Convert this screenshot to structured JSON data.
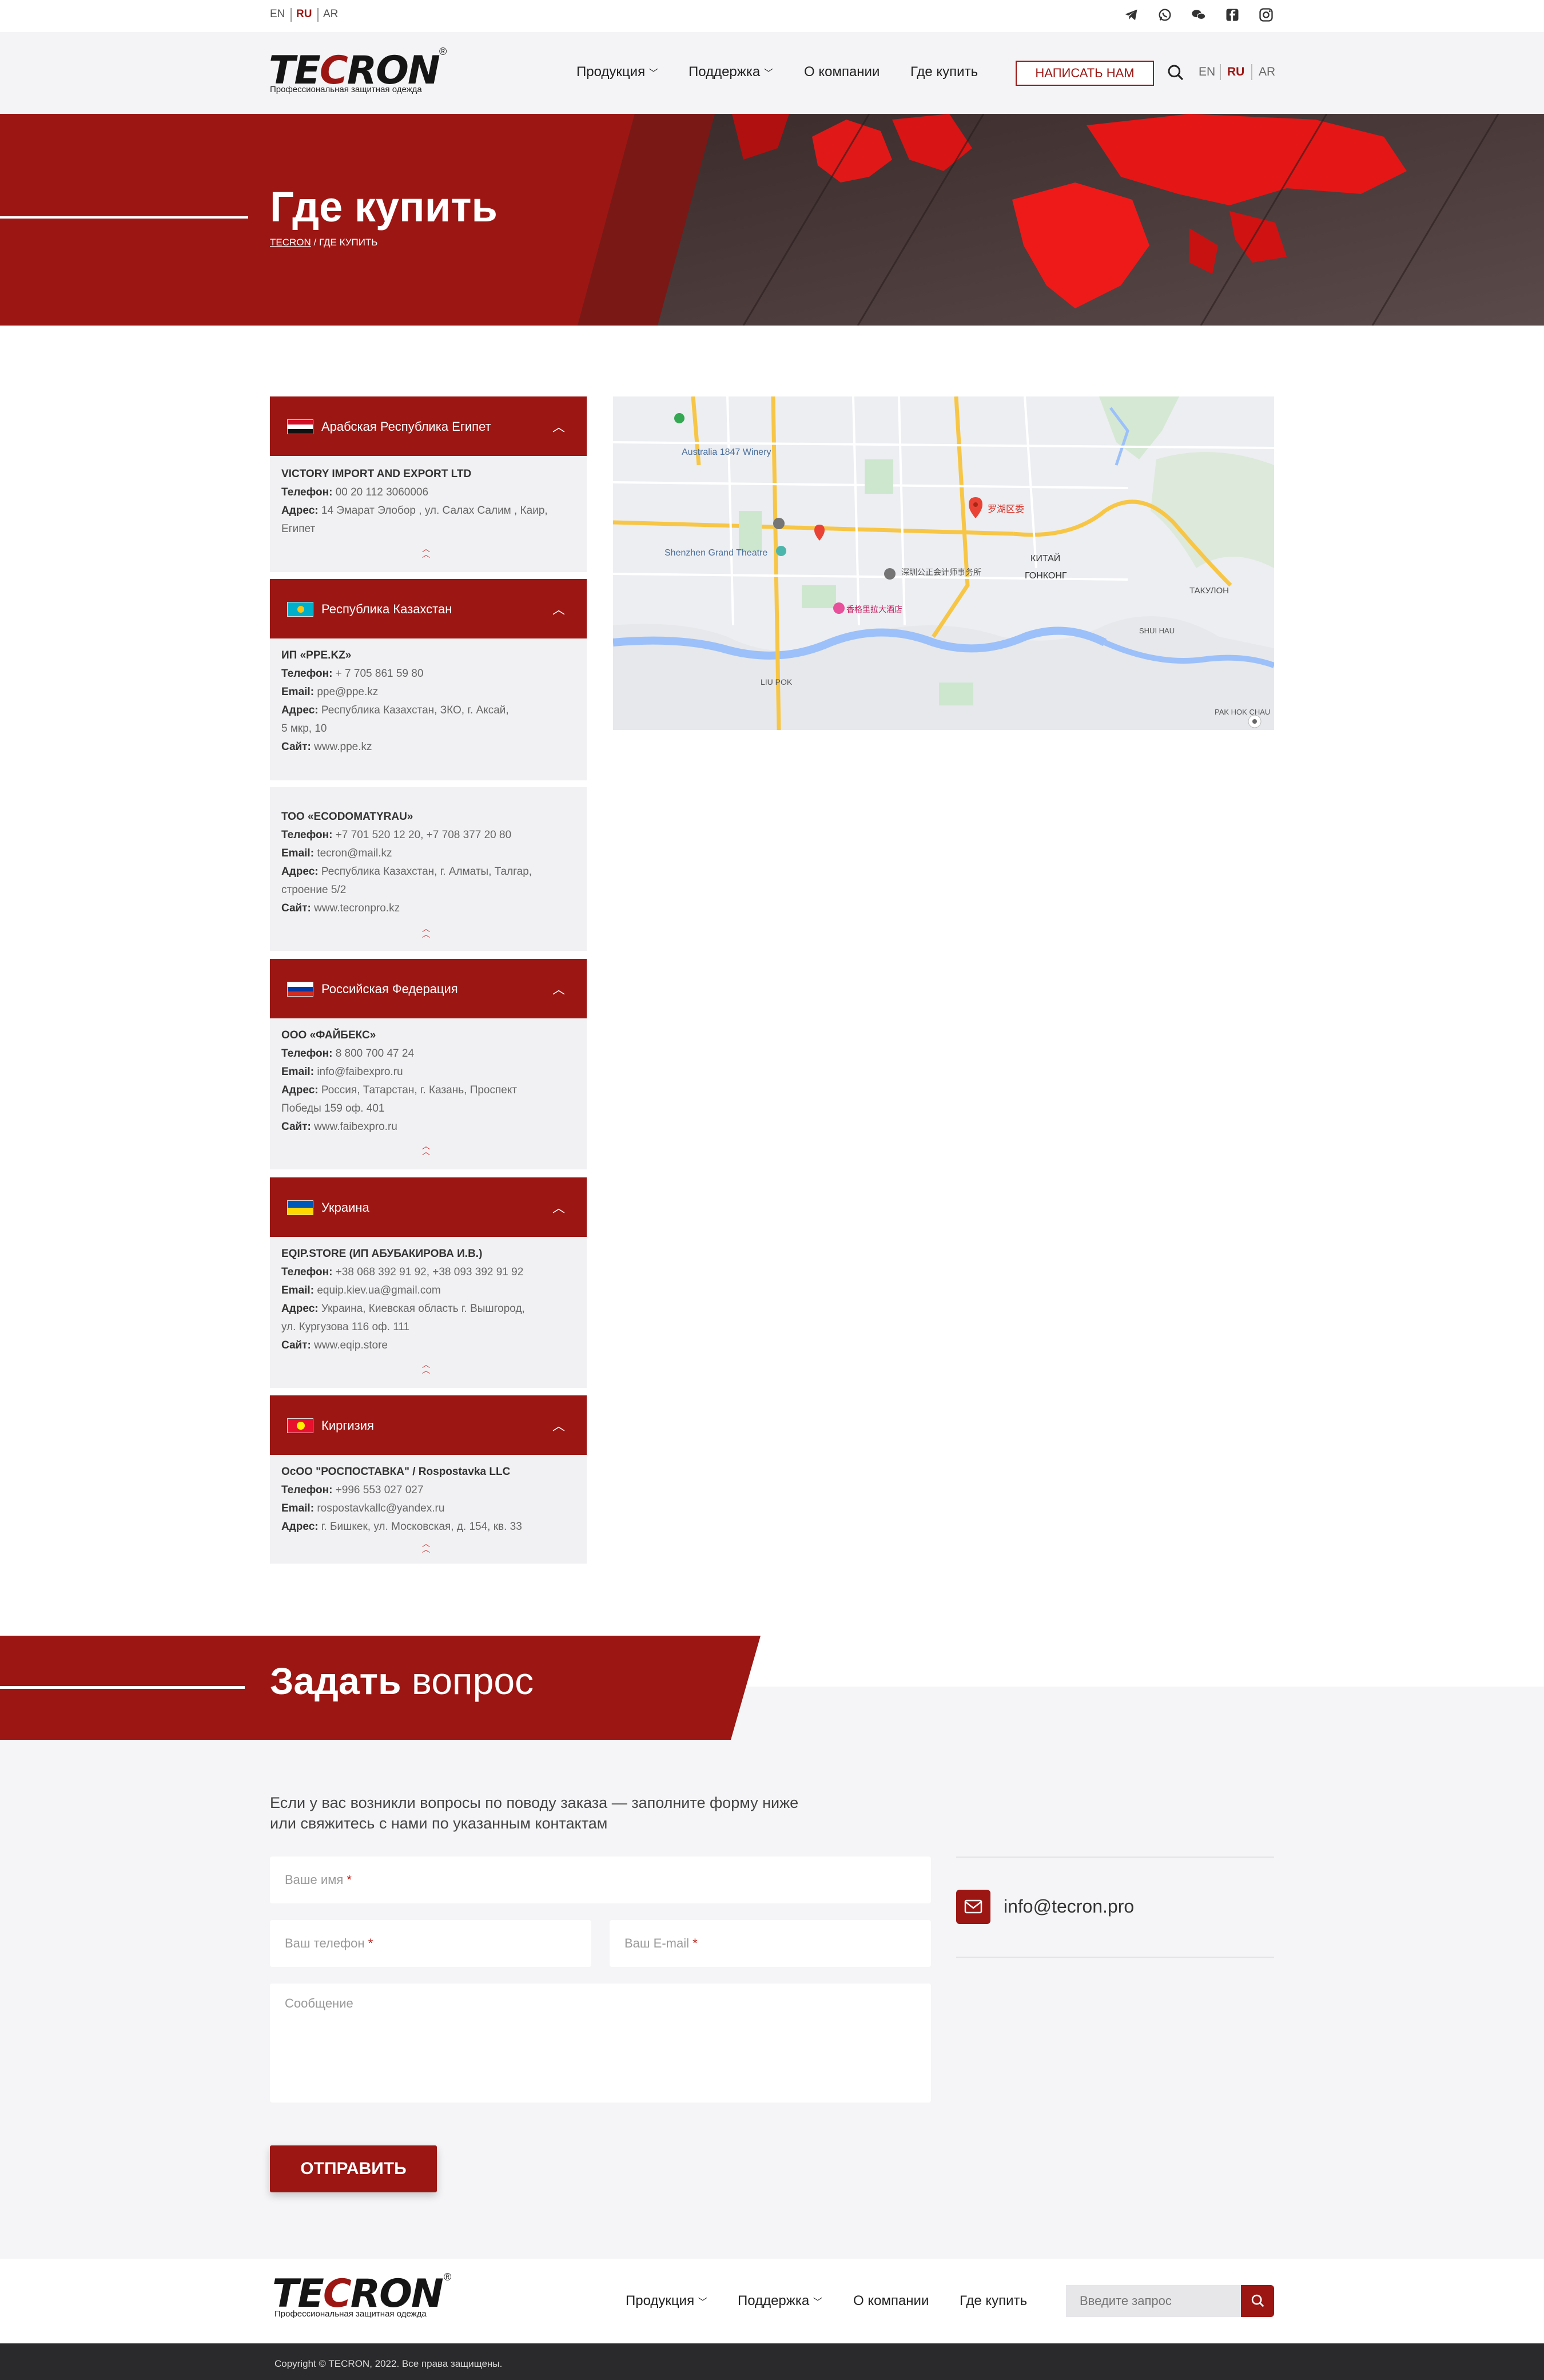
{
  "top_langs": [
    "EN",
    "RU",
    "AR"
  ],
  "social": [
    "telegram-icon",
    "whatsapp-icon",
    "wechat-icon",
    "facebook-icon",
    "instagram-icon"
  ],
  "header": {
    "logo": "TECRON",
    "logo_mark": "®",
    "logo_sub": "Профессиональная защитная одежда",
    "nav": [
      "Продукция",
      "Поддержка",
      "О компании",
      "Где купить"
    ],
    "write_btn": "НАПИСАТЬ НАМ",
    "langs": [
      "EN",
      "RU",
      "AR"
    ]
  },
  "hero": {
    "title": "Где купить",
    "crumb_home": "TECRON",
    "crumb_current": " / ГДЕ КУПИТЬ"
  },
  "countries": [
    {
      "name": "Арабская Республика Египет",
      "dealers": [
        {
          "company": "VICTORY IMPORT AND EXPORT LTD",
          "phone": "00 20 112 3060006",
          "address_l1": "14 Эмарат Элобор , ул. Салах Салим , Каир,",
          "address_l2": "Египет"
        }
      ]
    },
    {
      "name": "Республика Казахстан",
      "dealers": [
        {
          "company": "ИП «PPE.KZ»",
          "phone": "+ 7 705 861 59 80",
          "email": "ppe@ppe.kz",
          "address_l1": "Республика Казахстан, ЗКО, г. Аксай,",
          "address_l2": "5 мкр, 10",
          "site": "www.ppe.kz"
        },
        {
          "company": "ТОО «ECODOMATYRAU»",
          "phone": "+7 701 520 12 20, +7  708  377 20 80",
          "email": "tecron@mail.kz",
          "address_l1": "Республика Казахстан, г. Алматы, Талгар,",
          "address_l2": "строение 5/2",
          "site": "www.tecronpro.kz"
        }
      ]
    },
    {
      "name": "Российская Федерация",
      "dealers": [
        {
          "company": "ООО «ФАЙБЕКС»",
          "phone": "8  800  700 47 24",
          "email": "info@faibexpro.ru",
          "address_l1": "Россия, Татарстан, г. Казань, Проспект",
          "address_l2": "Победы 159 оф. 401",
          "site": "www.faibexpro.ru"
        }
      ]
    },
    {
      "name": "Украина",
      "dealers": [
        {
          "company": "EQIP.STORE (ИП АБУБАКИРОВА И.В.)",
          "phone": "+38 068 392 91 92, +38 093 392 91 92",
          "email": "equip.kiev.ua@gmail.com",
          "address_l1": "Украина, Киевская область г. Вышгород,",
          "address_l2": "ул. Кургузова 116 оф. 111",
          "site": "www.eqip.store"
        }
      ]
    },
    {
      "name": "Киргизия",
      "dealers": [
        {
          "company": "ОсОО \"РОСПОСТАВКА\" / Rospostavka LLC",
          "phone": "+996 553 027 027",
          "email": "rospostavkallc@yandex.ru",
          "address_l1": "г. Бишкек, ул. Московская, д. 154, кв. 33"
        }
      ]
    }
  ],
  "labels": {
    "phone": "Телефон:",
    "email": "Email:",
    "address": "Адрес:",
    "site": "Сайт:"
  },
  "map": {
    "labels": [
      "Australia 1847 Winery",
      "Shenzhen Grand Theatre",
      "罗湖区委",
      "КИТАЙ",
      "ГОНКОНГ",
      "ТАКУЛОН",
      "LIU POK",
      "SHUI HAU",
      "PAK HOK CHAU",
      "香格里拉大酒店",
      "深圳公正会计师事务所"
    ]
  },
  "ask": {
    "title_bold": "Задать",
    "title_rest": " вопрос",
    "desc_l1": "Если у вас возникли вопросы по поводу заказа — заполните форму ниже",
    "desc_l2": "или свяжитесь с нами по указанным контактам",
    "name_ph": "Ваше имя",
    "phone_ph": "Ваш телефон",
    "email_ph": "Ваш E-mail",
    "message_ph": "Сообщение",
    "required_mark": "*",
    "send": "ОТПРАВИТЬ",
    "contact_email": "info@tecron.pro"
  },
  "footer": {
    "nav": [
      "Продукция",
      "Поддержка",
      "О компании",
      "Где купить"
    ],
    "search_ph": "Введите запрос",
    "copyright": "Copyright © TECRON, 2022. Все права защищены."
  },
  "colors": {
    "brand": "#9c1613",
    "light_bg": "#f4f4f6",
    "dark": "#2a2a2c"
  }
}
